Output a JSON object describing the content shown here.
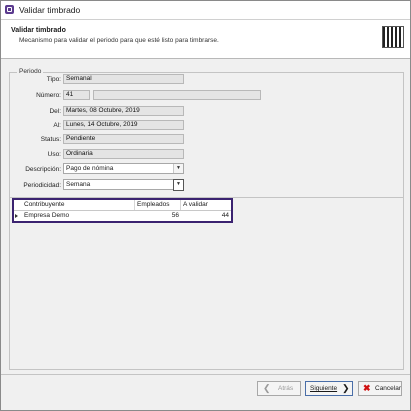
{
  "window": {
    "title": "Validar timbrado"
  },
  "header": {
    "title": "Validar timbrado",
    "subtitle": "Mecanismo para validar el periodo para que esté listo para timbrarse."
  },
  "periodo": {
    "legend": "Periodo",
    "tipo_label": "Tipo:",
    "tipo_value": "Semanal",
    "numero_label": "Número:",
    "numero_value": "41",
    "numero_extra": "",
    "del_label": "Del:",
    "del_value": "Martes, 08 Octubre, 2019",
    "al_label": "Al:",
    "al_value": "Lunes, 14 Octubre, 2019",
    "status_label": "Status:",
    "status_value": "Pendiente",
    "uso_label": "Uso:",
    "uso_value": "Ordinaria",
    "descripcion_label": "Descripción:",
    "descripcion_value": "Pago de nómina",
    "periodicidad_label": "Periodicidad:",
    "periodicidad_value": "Semana"
  },
  "grid": {
    "columns": [
      "Contribuyente",
      "Empleados",
      "A validar"
    ],
    "rows": [
      {
        "contribuyente": "Empresa Demo",
        "empleados": "56",
        "a_validar": "44"
      }
    ]
  },
  "buttons": {
    "atras": "Atrás",
    "siguiente": "Siguiente",
    "cancelar": "Cancelar"
  },
  "colors": {
    "grid_highlight": "#3b2370",
    "cancel_icon": "#d01010"
  }
}
